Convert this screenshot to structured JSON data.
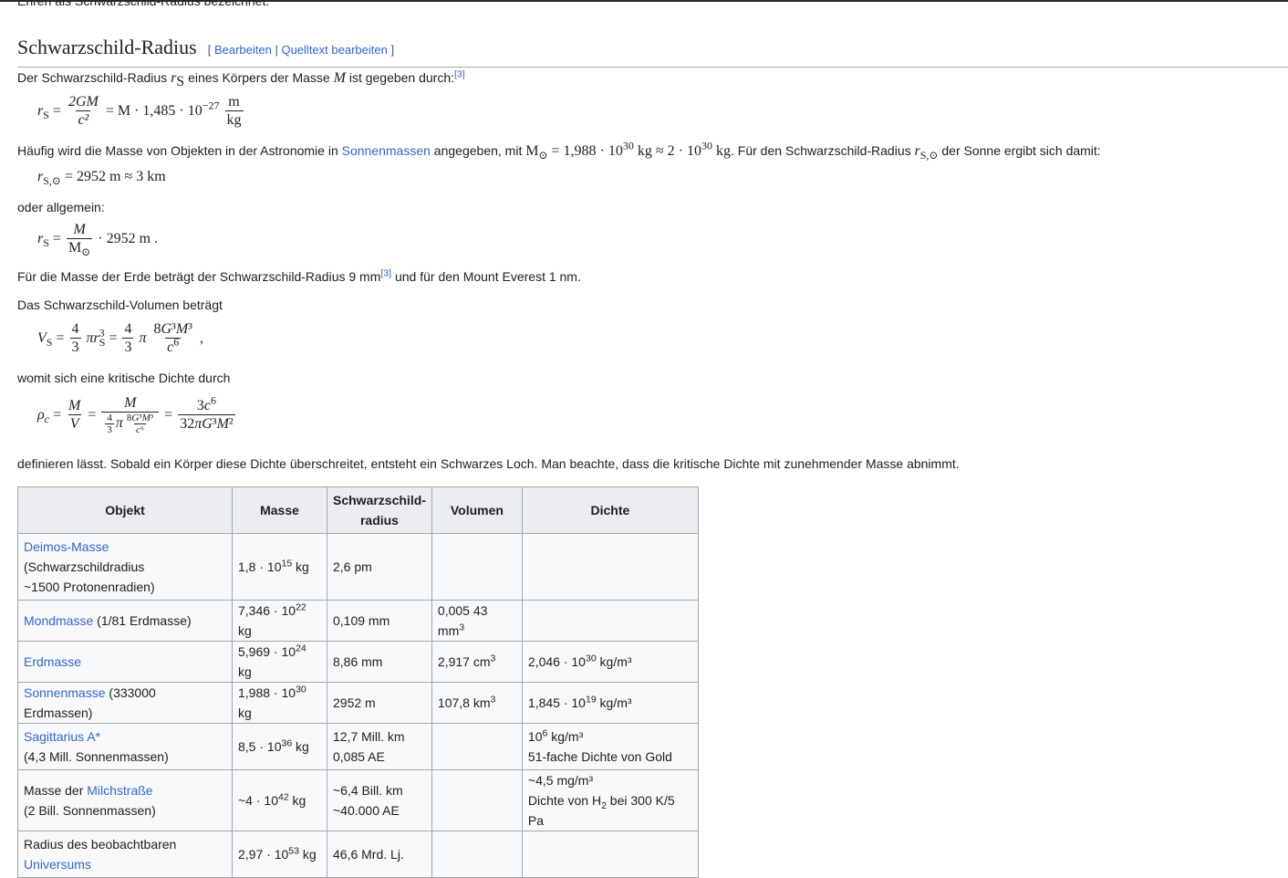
{
  "cut_text": "Ehren als Schwarzschild-Radius bezeichnet.",
  "section": {
    "title": "Schwarzschild-Radius",
    "edit_open": "[ ",
    "edit_link": "Bearbeiten",
    "edit_sep": " | ",
    "source_link": "Quelltext bearbeiten",
    "edit_close": " ]"
  },
  "para1": {
    "a": "Der Schwarzschild-Radius ",
    "b": " eines Körpers der Masse ",
    "c": " ist gegeben durch:",
    "ref": "[3]"
  },
  "formula1": {
    "num": "2GM",
    "den": "c²",
    "rest": "= M · 1,485 · 10",
    "exp": "−27",
    "unit_num": "m",
    "unit_den": "kg"
  },
  "para2": {
    "a": "Häufig wird die Masse von Objekten in der Astronomie in ",
    "link": "Sonnenmassen",
    "b": " angegeben, mit ",
    "math": "= 1,988 · 10",
    "exp1": "30",
    "math2": " kg ≈ 2 · 10",
    "exp2": "30",
    "math3": " kg",
    "c": ". Für den Schwarzschild-Radius ",
    "d": " der Sonne ergibt sich damit:"
  },
  "formula2": {
    "rest": "= 2952 m ≈ 3 km"
  },
  "para3": "oder allgemein:",
  "formula3": {
    "num": "M",
    "den": "M",
    "rest": "· 2952 m",
    "dot": "."
  },
  "para4": {
    "a": "Für die Masse der Erde beträgt der Schwarzschild-Radius 9 mm",
    "ref": "[3]",
    "b": " und für den Mount Everest 1 nm."
  },
  "para5": "Das Schwarzschild-Volumen beträgt",
  "para6": "womit sich eine kritische Dichte durch",
  "para7": "definieren lässt. Sobald ein Körper diese Dichte überschreitet, entsteht ein Schwarzes Loch. Man beachte, dass die kritische Dichte mit zunehmender Masse abnimmt.",
  "table": {
    "headers": [
      "Objekt",
      "Masse",
      "Schwarzschild-radius",
      "Volumen",
      "Dichte"
    ],
    "rows": [
      {
        "link": "Deimos-Masse",
        "rest": "",
        "line2": "(Schwarzschildradius",
        "line3": "~1500 Protonenradien)",
        "masse_base": "1,8 · 10",
        "masse_exp": "15",
        "masse_unit": " kg",
        "radius1": "2,6 pm",
        "radius2": "",
        "vol_base": "",
        "vol_exp": "",
        "dichte1": "",
        "dichte_exp": "",
        "dichte_unit": "",
        "dichte2": ""
      },
      {
        "link": "Mondmasse",
        "rest": " (1/81 Erdmasse)",
        "masse_base": "7,346 · 10",
        "masse_exp": "22",
        "masse_unit": " kg",
        "radius1": "0,109 mm",
        "vol_base": "0,005 43 mm",
        "vol_exp": "3",
        "dichte1": "",
        "dichte_exp": "",
        "dichte_unit": ""
      },
      {
        "link": "Erdmasse",
        "rest": "",
        "masse_base": "5,969 · 10",
        "masse_exp": "24",
        "masse_unit": " kg",
        "radius1": "8,86 mm",
        "vol_base": "2,917 cm",
        "vol_exp": "3",
        "dichte1": "2,046 · 10",
        "dichte_exp": "30",
        "dichte_unit": " kg/m³"
      },
      {
        "link": "Sonnenmasse",
        "rest": " (333000 Erdmassen)",
        "masse_base": "1,988 · 10",
        "masse_exp": "30",
        "masse_unit": " kg",
        "radius1": "2952 m",
        "vol_base": "107,8 km",
        "vol_exp": "3",
        "dichte1": "1,845 · 10",
        "dichte_exp": "19",
        "dichte_unit": " kg/m³"
      },
      {
        "link": "Sagittarius A*",
        "line2": "(4,3 Mill. Sonnenmassen)",
        "masse_base": "8,5 · 10",
        "masse_exp": "36",
        "masse_unit": " kg",
        "radius1": "12,7 Mill. km",
        "radius2": "0,085 AE",
        "dichte1": "10",
        "dichte_exp": "6",
        "dichte_unit": " kg/m³",
        "dichte2": "51-fache Dichte von Gold"
      },
      {
        "pre": "Masse der ",
        "link": "Milchstraße",
        "line2": "(2 Bill. Sonnenmassen)",
        "masse_base": "~4 · 10",
        "masse_exp": "42",
        "masse_unit": " kg",
        "radius1": "~6,4 Bill. km",
        "radius2": "~40.000 AE",
        "dichte1": "~4,5 mg/m³",
        "dichte2_a": "Dichte von H",
        "dichte2_sub": "2",
        "dichte2_b": " bei 300 K/5 Pa"
      },
      {
        "pre": "Radius des beobachtbaren",
        "link": "Universums",
        "masse_base": "2,97 · 10",
        "masse_exp": "53",
        "masse_unit": " kg",
        "radius1": "46,6 Mrd. Lj."
      }
    ]
  }
}
